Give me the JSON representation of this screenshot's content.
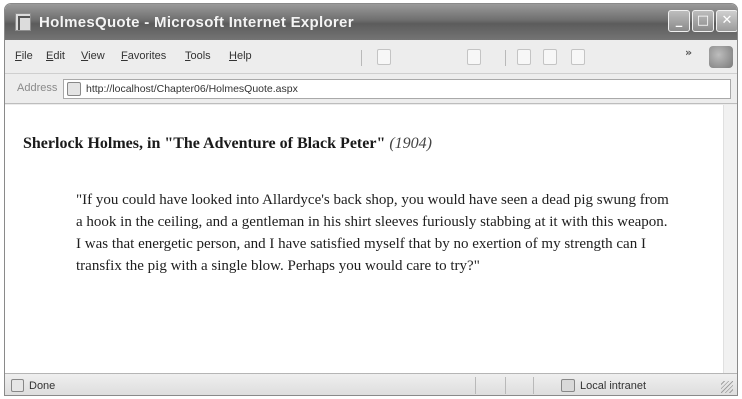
{
  "window": {
    "title": "HolmesQuote - Microsoft Internet Explorer"
  },
  "caption_buttons": {
    "minimize": "_",
    "maximize": "□",
    "close": "✕"
  },
  "menu": {
    "items": [
      {
        "label": "File"
      },
      {
        "label": "Edit"
      },
      {
        "label": "View"
      },
      {
        "label": "Favorites"
      },
      {
        "label": "Tools"
      },
      {
        "label": "Help"
      }
    ],
    "overflow_label": "»"
  },
  "address": {
    "label": "Address",
    "url": "http://localhost/Chapter06/HolmesQuote.aspx"
  },
  "page": {
    "heading_person": "Sherlock Holmes, in",
    "heading_story": "\"The Adventure of Black Peter\"",
    "heading_year": "(1904)",
    "quote": "\"If you could have looked into Allardyce's back shop, you would have seen a dead pig swung from a hook in the ceiling, and a gentleman in his shirt sleeves furiously stabbing at it with this weapon. I was that energetic person, and I have satisfied myself that by no exertion of my strength can I transfix the pig with a single blow. Perhaps you would care to try?\""
  },
  "status": {
    "text": "Done",
    "zone": "Local intranet"
  },
  "icons": {
    "title": "ie-page-icon",
    "address": "page-icon",
    "status": "page-done-icon",
    "zone": "local-intranet-icon",
    "logo": "windows-logo-icon"
  }
}
